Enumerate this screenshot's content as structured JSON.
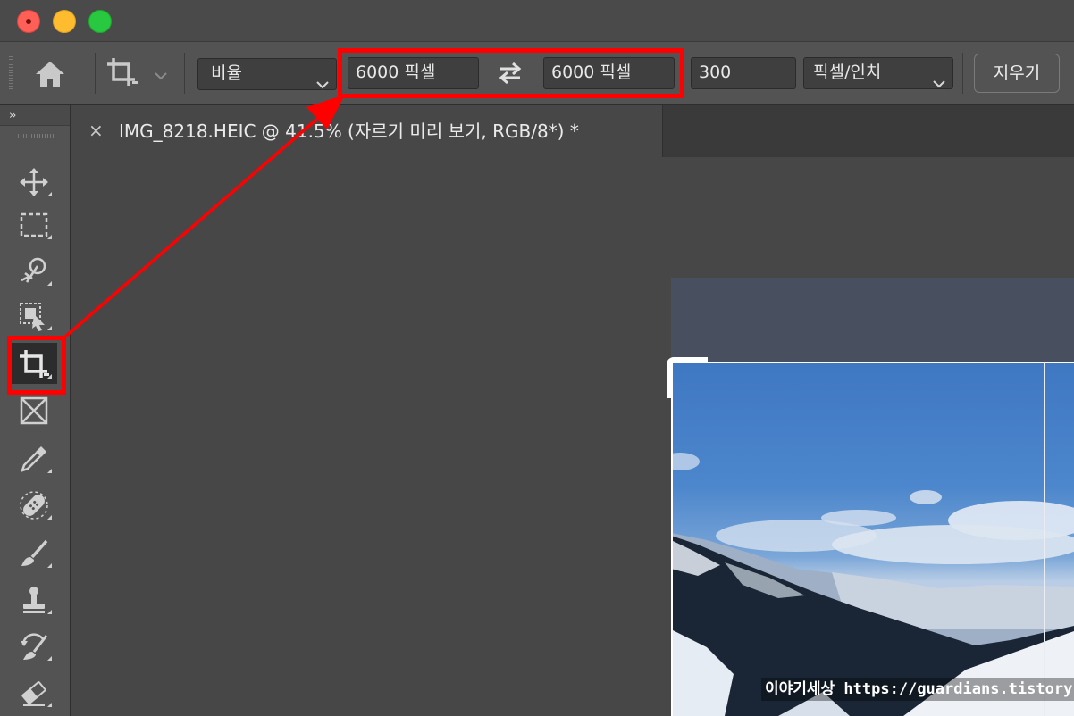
{
  "window": {
    "traffic_lights": [
      "close",
      "minimize",
      "zoom"
    ]
  },
  "options_bar": {
    "ratio_select": "비율",
    "width_value": "6000 픽셀",
    "height_value": "6000 픽셀",
    "resolution_value": "300",
    "unit_select": "픽셀/인치",
    "clear_button": "지우기",
    "icons": [
      "home-icon",
      "crop-icon",
      "chevron-down-icon",
      "swap-icon"
    ]
  },
  "toolbar": {
    "expand_label": "››",
    "tools": [
      "move",
      "marquee",
      "object-selection",
      "artboard",
      "crop",
      "frame",
      "eyedropper",
      "healing-brush",
      "brush",
      "clone-stamp",
      "history-brush",
      "eraser"
    ],
    "active_tool": "crop"
  },
  "document": {
    "tab_close": "×",
    "tab_title": "IMG_8218.HEIC @ 41.5% (자르기 미리 보기, RGB/8*) *"
  },
  "annotation": {
    "color": "#ff0000"
  },
  "watermark": {
    "text": "이야기세상 https://guardians.tistory.com"
  }
}
